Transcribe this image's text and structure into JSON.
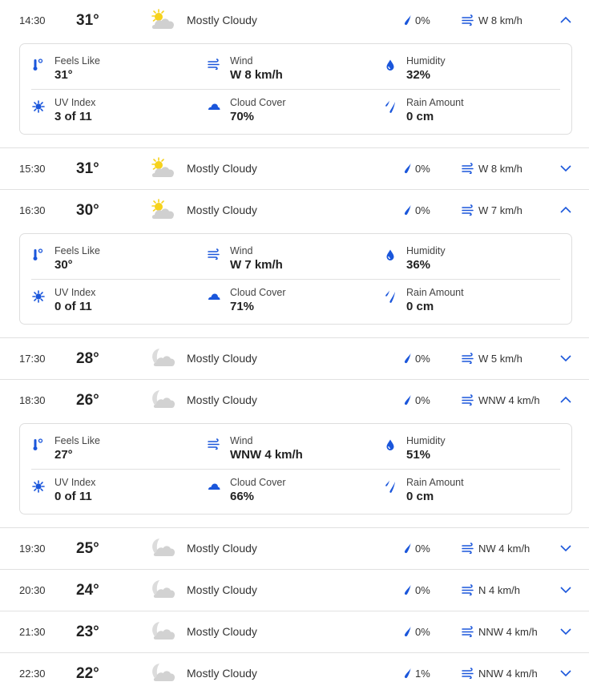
{
  "colors": {
    "accent": "#1a56db",
    "divider": "#e1e1e1",
    "sun": "#f6d21c",
    "cloud": "#cfcfcf"
  },
  "detail_labels": {
    "feels_like": "Feels Like",
    "wind": "Wind",
    "humidity": "Humidity",
    "uv_index": "UV Index",
    "cloud_cover": "Cloud Cover",
    "rain_amount": "Rain Amount"
  },
  "hours": [
    {
      "time": "14:30",
      "temp": "31°",
      "icon": "partly-sunny-cloud-icon",
      "condition": "Mostly Cloudy",
      "precip": "0%",
      "wind": "W 8 km/h",
      "expanded": true,
      "details": {
        "feels_like": "31°",
        "wind": "W 8 km/h",
        "humidity": "32%",
        "uv_index": "3 of 11",
        "cloud_cover": "70%",
        "rain_amount": "0 cm"
      }
    },
    {
      "time": "15:30",
      "temp": "31°",
      "icon": "partly-sunny-cloud-icon",
      "condition": "Mostly Cloudy",
      "precip": "0%",
      "wind": "W 8 km/h",
      "expanded": false
    },
    {
      "time": "16:30",
      "temp": "30°",
      "icon": "partly-sunny-cloud-icon",
      "condition": "Mostly Cloudy",
      "precip": "0%",
      "wind": "W 7 km/h",
      "expanded": true,
      "details": {
        "feels_like": "30°",
        "wind": "W 7 km/h",
        "humidity": "36%",
        "uv_index": "0 of 11",
        "cloud_cover": "71%",
        "rain_amount": "0 cm"
      }
    },
    {
      "time": "17:30",
      "temp": "28°",
      "icon": "moon-cloud-icon",
      "condition": "Mostly Cloudy",
      "precip": "0%",
      "wind": "W 5 km/h",
      "expanded": false
    },
    {
      "time": "18:30",
      "temp": "26°",
      "icon": "moon-cloud-icon",
      "condition": "Mostly Cloudy",
      "precip": "0%",
      "wind": "WNW 4 km/h",
      "expanded": true,
      "details": {
        "feels_like": "27°",
        "wind": "WNW 4 km/h",
        "humidity": "51%",
        "uv_index": "0 of 11",
        "cloud_cover": "66%",
        "rain_amount": "0 cm"
      }
    },
    {
      "time": "19:30",
      "temp": "25°",
      "icon": "moon-cloud-icon",
      "condition": "Mostly Cloudy",
      "precip": "0%",
      "wind": "NW 4 km/h",
      "expanded": false
    },
    {
      "time": "20:30",
      "temp": "24°",
      "icon": "moon-cloud-icon",
      "condition": "Mostly Cloudy",
      "precip": "0%",
      "wind": "N 4 km/h",
      "expanded": false
    },
    {
      "time": "21:30",
      "temp": "23°",
      "icon": "moon-cloud-icon",
      "condition": "Mostly Cloudy",
      "precip": "0%",
      "wind": "NNW 4 km/h",
      "expanded": false
    },
    {
      "time": "22:30",
      "temp": "22°",
      "icon": "moon-cloud-icon",
      "condition": "Mostly Cloudy",
      "precip": "1%",
      "wind": "NNW 4 km/h",
      "expanded": false
    }
  ]
}
